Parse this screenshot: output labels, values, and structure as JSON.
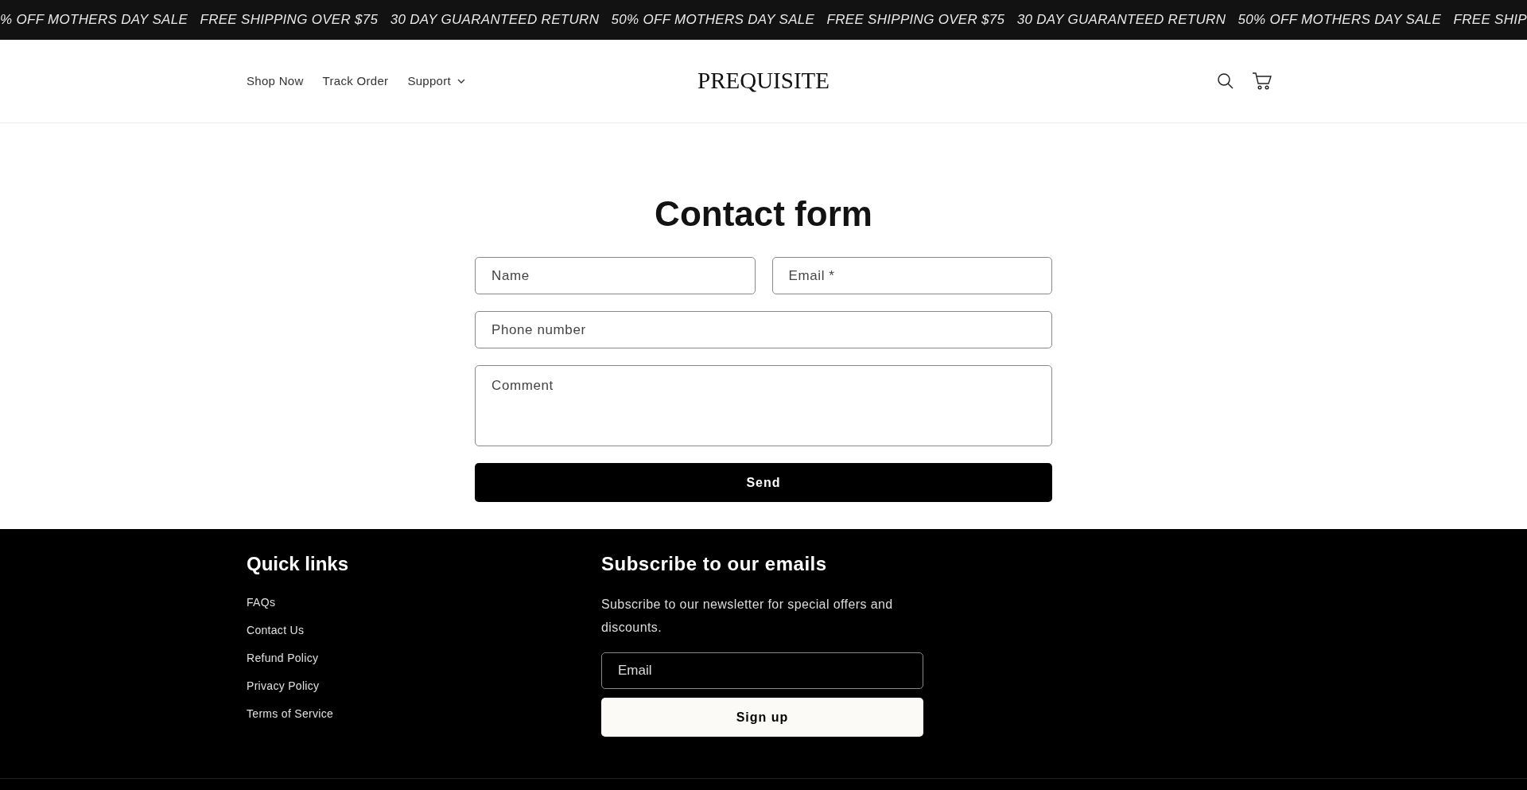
{
  "announcement_bar": {
    "items": [
      "% OFF MOTHERS DAY SALE",
      "FREE SHIPPING OVER $75",
      "30 DAY GUARANTEED RETURN",
      "50% OFF MOTHERS DAY SALE",
      "FREE SHIPPING OVER $75",
      "30 DAY GUARANTEED RETURN",
      "50% OFF MOTHERS DAY SALE",
      "FREE SHIP"
    ]
  },
  "header": {
    "nav": [
      {
        "label": "Shop Now",
        "dropdown": false
      },
      {
        "label": "Track Order",
        "dropdown": false
      },
      {
        "label": "Support",
        "dropdown": true
      }
    ],
    "logo": "PREQUISITE"
  },
  "contact_form": {
    "title": "Contact form",
    "fields": [
      {
        "placeholder": "Name",
        "kind": "half"
      },
      {
        "placeholder": "Email *",
        "kind": "half"
      },
      {
        "placeholder": "Phone number",
        "kind": "full"
      },
      {
        "placeholder": "Comment",
        "kind": "textarea"
      }
    ],
    "button": "Send"
  },
  "footer": {
    "quick_links": {
      "title": "Quick links",
      "links": [
        "FAQs",
        "Contact Us",
        "Refund Policy",
        "Privacy Policy",
        "Terms of Service"
      ]
    },
    "subscribe": {
      "title": "Subscribe to our emails",
      "text": "Subscribe to our newsletter for special offers and discounts.",
      "placeholder": "Email",
      "button": "Sign up"
    }
  }
}
